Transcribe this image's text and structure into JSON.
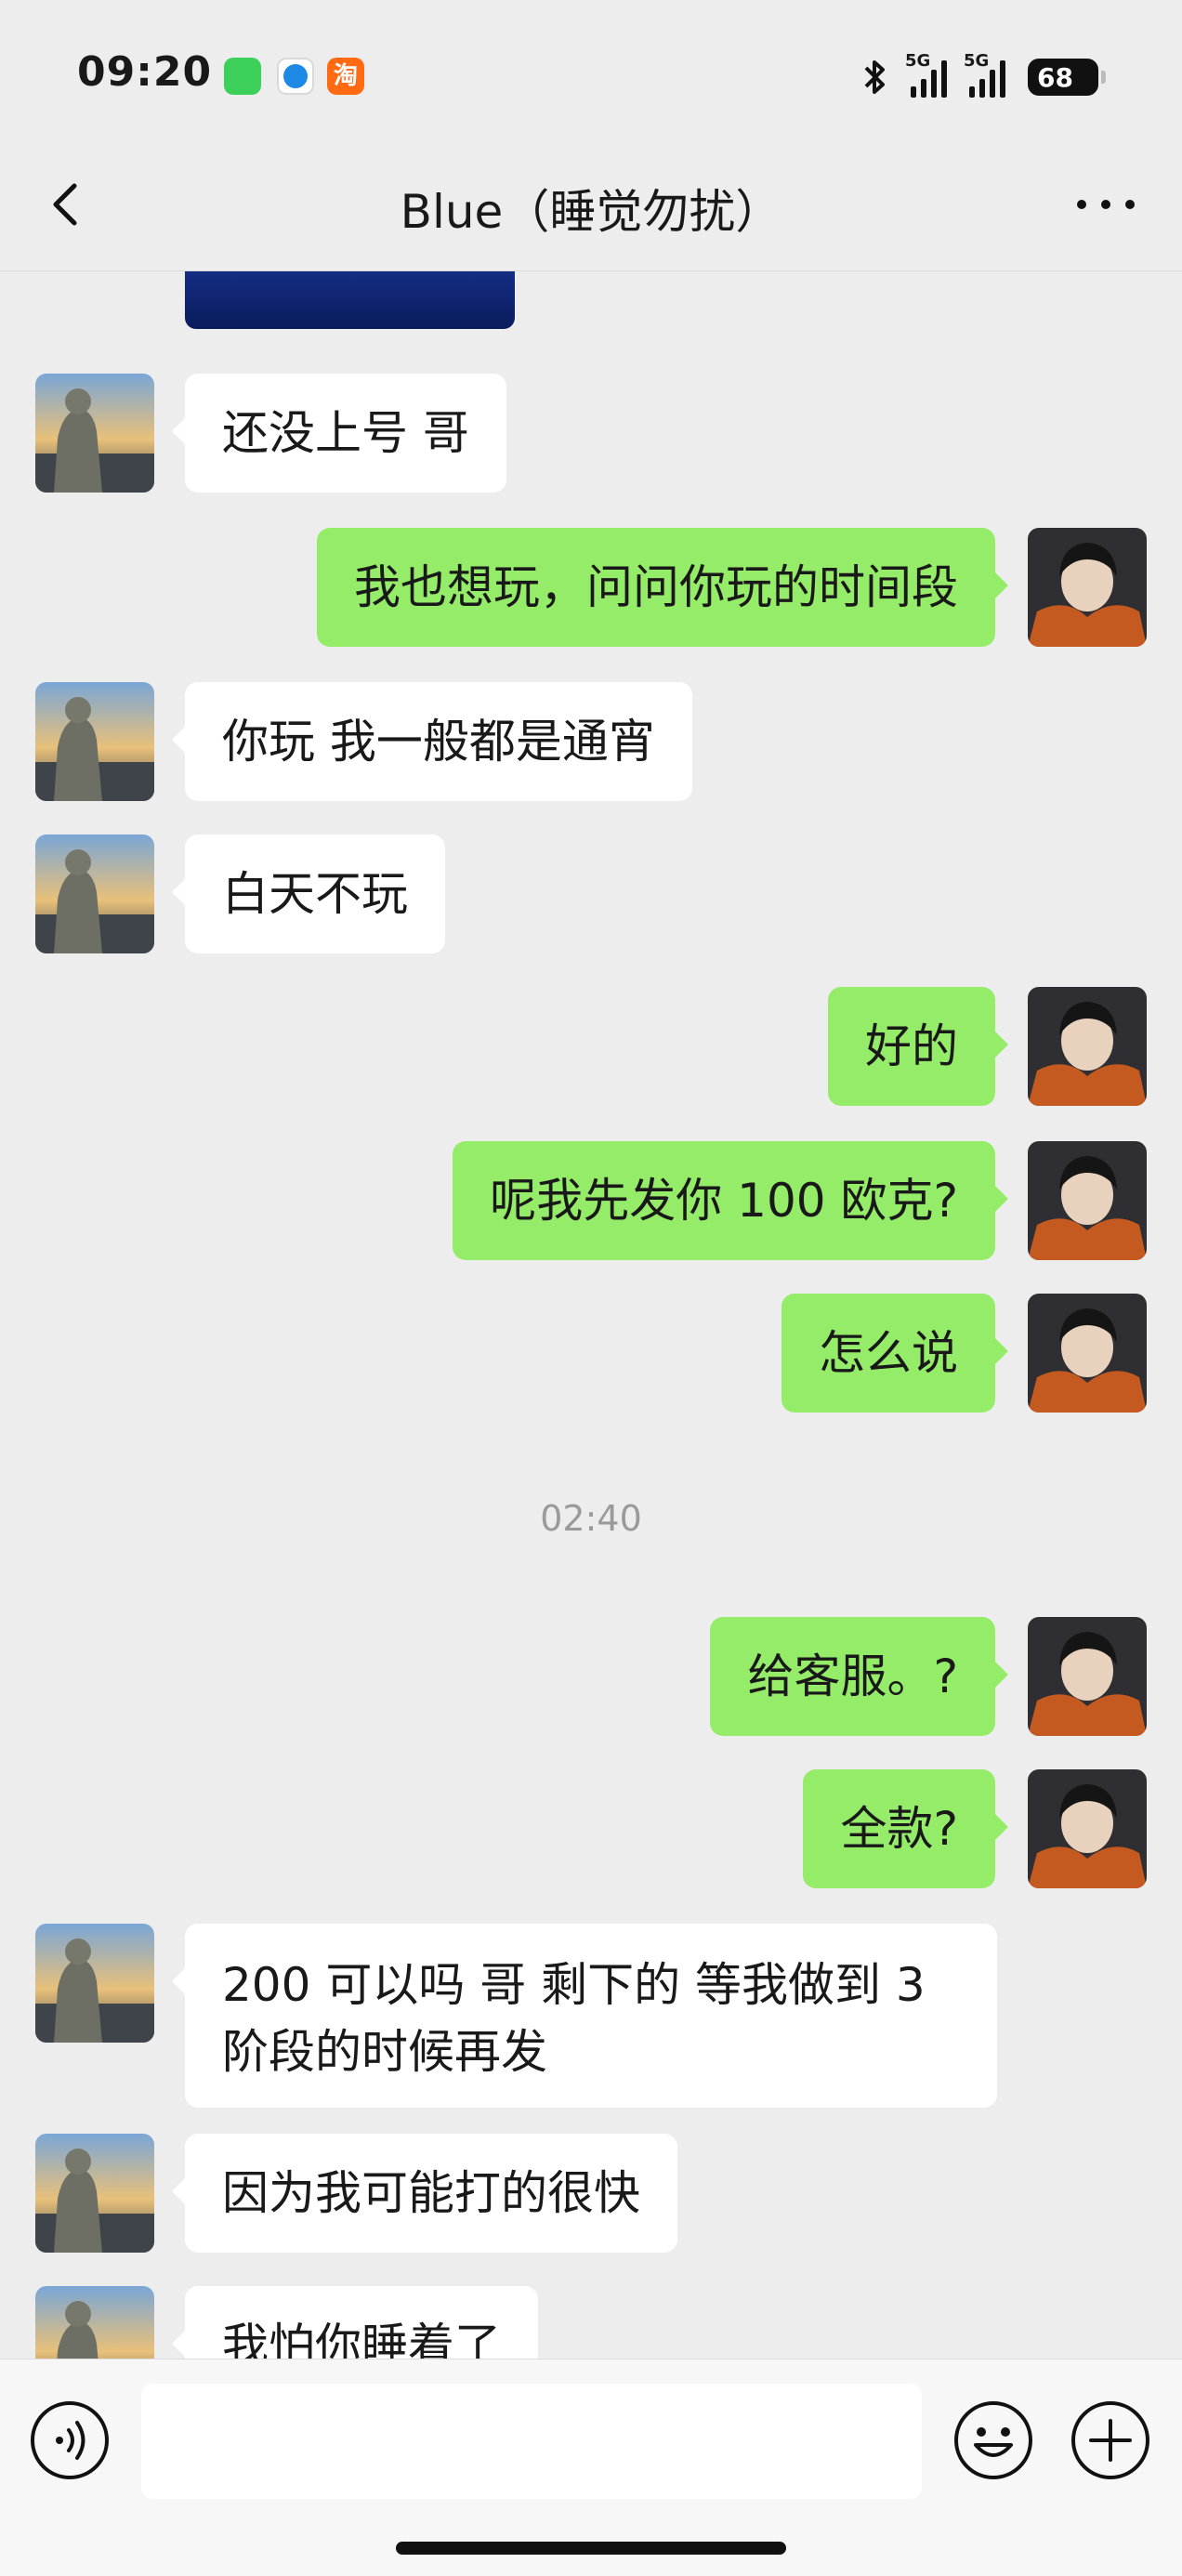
{
  "status_bar": {
    "time": "09:20",
    "taobao_glyph": "淘",
    "network_1": "5G",
    "network_2": "5G",
    "battery": "68",
    "icons": [
      "messages-app-icon",
      "safari-icon",
      "taobao-icon",
      "bluetooth-icon",
      "signal-icon",
      "battery-icon"
    ]
  },
  "nav": {
    "title": "Blue（睡觉勿扰）",
    "back_icon": "chevron-left-icon",
    "more_icon": "more-dots-icon"
  },
  "messages": [
    {
      "side": "in",
      "text": "还没上号 哥"
    },
    {
      "side": "out",
      "text": "我也想玩，问问你玩的时间段"
    },
    {
      "side": "in",
      "text": "你玩 我一般都是通宵"
    },
    {
      "side": "in",
      "text": "白天不玩"
    },
    {
      "side": "out",
      "text": "好的"
    },
    {
      "side": "out",
      "text": "呢我先发你 100 欧克?"
    },
    {
      "side": "out",
      "text": "怎么说"
    },
    {
      "side": "out",
      "text": "给客服。?"
    },
    {
      "side": "out",
      "text": "全款?"
    },
    {
      "side": "in",
      "text": "200 可以吗 哥 剩下的 等我做到 3 阶段的时候再发"
    },
    {
      "side": "in",
      "text": "因为我可能打的很快"
    },
    {
      "side": "in",
      "text": "我怕你睡着了"
    }
  ],
  "time_separator": "02:40",
  "input_bar": {
    "placeholder": "",
    "icons": [
      "voice-icon",
      "emoji-icon",
      "plus-icon"
    ]
  },
  "colors": {
    "background": "#ededed",
    "outgoing_bubble": "#95ec69",
    "incoming_bubble": "#ffffff"
  }
}
